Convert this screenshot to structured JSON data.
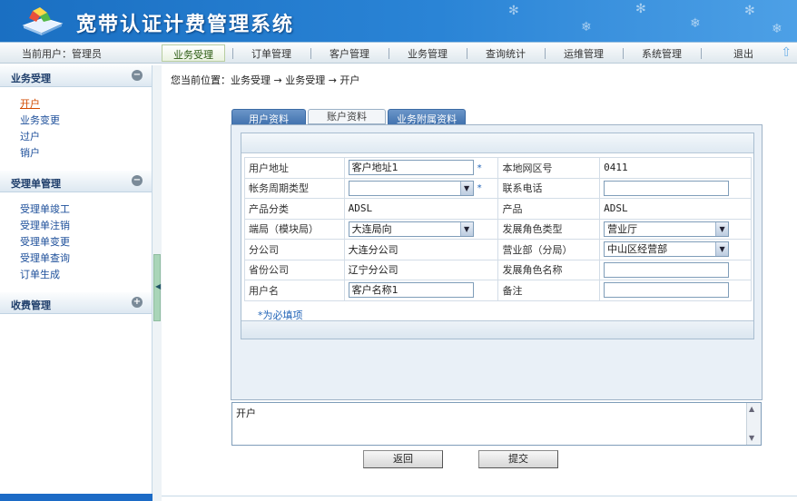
{
  "header": {
    "title": "宽带认证计费管理系统"
  },
  "nav": {
    "current_user": "当前用户：管理员",
    "items": [
      "业务受理",
      "订单管理",
      "客户管理",
      "业务管理",
      "查询统计",
      "运维管理",
      "系统管理",
      "退出"
    ]
  },
  "sidebar": {
    "sections": [
      {
        "title": "业务受理",
        "toggle": "−",
        "items": [
          "开户",
          "业务变更",
          "过户",
          "销户"
        ]
      },
      {
        "title": "受理单管理",
        "toggle": "−",
        "items": [
          "受理单竣工",
          "受理单注销",
          "受理单变更",
          "受理单查询",
          "订单生成"
        ]
      },
      {
        "title": "收费管理",
        "toggle": "+",
        "items": []
      }
    ]
  },
  "breadcrumb": "您当前位置：业务受理 → 业务受理 → 开户",
  "tabs": [
    "用户资料",
    "账户资料",
    "业务附属资料"
  ],
  "form": {
    "user_address_label": "用户地址",
    "user_address_value": "客户地址1",
    "local_area_label": "本地网区号",
    "local_area_value": "0411",
    "billing_cycle_label": "帐务周期类型",
    "billing_cycle_value": "",
    "phone_label": "联系电话",
    "phone_value": "",
    "product_class_label": "产品分类",
    "product_class_value": "ADSL",
    "product_label": "产品",
    "product_value": "ADSL",
    "office_label": "端局（模块局）",
    "office_value": "大连局向",
    "dev_role_type_label": "发展角色类型",
    "dev_role_type_value": "营业厅",
    "branch_label": "分公司",
    "branch_value": "大连分公司",
    "business_dept_label": "营业部（分局）",
    "business_dept_value": "中山区经营部",
    "province_label": "省份公司",
    "province_value": "辽宁分公司",
    "dev_role_name_label": "发展角色名称",
    "dev_role_name_value": "",
    "username_label": "用户名",
    "username_value": "客户名称1",
    "remark_label": "备注",
    "remark_value": "",
    "required_note": "*为必填项",
    "star": "*"
  },
  "memo": "开户",
  "buttons": {
    "back": "返回",
    "submit": "提交"
  }
}
